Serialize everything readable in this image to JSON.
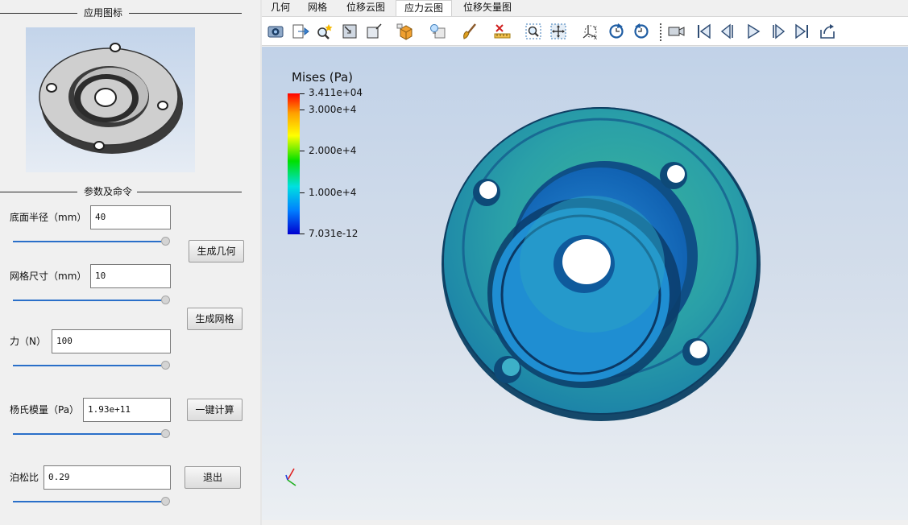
{
  "left_panel": {
    "icon_group_title": "应用图标",
    "params_group_title": "参数及命令",
    "fields": [
      {
        "label": "底面半径（mm）",
        "value": "40",
        "slider_value": 1.0
      },
      {
        "label": "网格尺寸（mm）",
        "value": "10",
        "slider_value": 1.0
      },
      {
        "label": "力（N）",
        "value": "100",
        "slider_value": 1.0
      },
      {
        "label": "杨氏模量（Pa）",
        "value": "1.93e+11",
        "slider_value": 1.0
      },
      {
        "label": "泊松比",
        "value": "0.29",
        "slider_value": 1.0
      }
    ],
    "buttons": {
      "gen_geometry": "生成几何",
      "gen_mesh": "生成网格",
      "compute": "一键计算",
      "exit": "退出"
    }
  },
  "tabs": [
    {
      "label": "几何",
      "selected": false
    },
    {
      "label": "网格",
      "selected": false
    },
    {
      "label": "位移云图",
      "selected": false
    },
    {
      "label": "应力云图",
      "selected": true
    },
    {
      "label": "位移矢量图",
      "selected": false
    }
  ],
  "toolbar_icons": [
    "camera-icon",
    "export-icon",
    "zoom-query-icon",
    "select-cell-icon",
    "select-box-icon",
    "cube-view-icon",
    "light-icon",
    "brush-icon",
    "ruler-icon",
    "zoom-box-icon",
    "fit-view-icon",
    "axes-orient-icon",
    "rotate-cw-icon",
    "rotate-ccw-icon",
    "video-icon",
    "first-frame-icon",
    "prev-frame-icon",
    "play-icon",
    "next-frame-icon",
    "last-frame-icon",
    "loop-icon"
  ],
  "viewport": {
    "colorbar": {
      "title": "Mises (Pa)",
      "labels": [
        "3.411e+04",
        "3.000e+4",
        "2.000e+4",
        "1.000e+4",
        "7.031e-12"
      ]
    }
  },
  "colors": {
    "accent": "#2a6fc9",
    "viewport_top": "#c1d2e8",
    "viewport_bottom": "#ebeff3"
  }
}
